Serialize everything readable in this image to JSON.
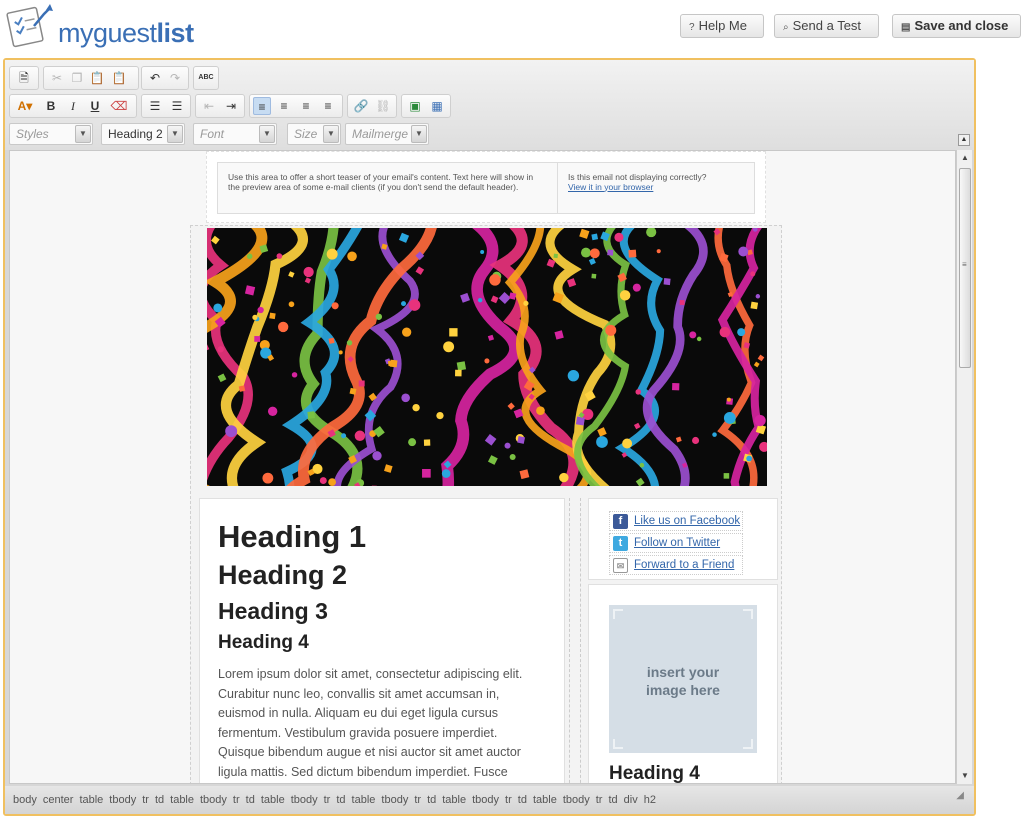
{
  "app": {
    "logo_prefix": "myguest",
    "logo_bold": "list"
  },
  "header_buttons": {
    "help": "Help Me",
    "help_icon": "?",
    "test": "Send a Test",
    "test_icon": "search-icon",
    "save": "Save and close",
    "save_icon": "disk-icon"
  },
  "toolbar": {
    "styles_placeholder": "Styles",
    "format_value": "Heading 2",
    "font_placeholder": "Font",
    "size_placeholder": "Size",
    "mailmerge_placeholder": "Mailmerge"
  },
  "email": {
    "preheader_left": "Use this area to offer a short teaser of your email's content. Text here will show in the preview area of some e-mail clients (if you don't send the default header).",
    "preheader_right_text": "Is this email not displaying correctly?",
    "preheader_right_link": "View it in your browser",
    "heading1": "Heading 1",
    "heading2": "Heading 2",
    "heading3": "Heading 3",
    "heading4": "Heading 4",
    "body_text": "Lorem ipsum dolor sit amet, consectetur adipiscing elit. Curabitur nunc leo, convallis sit amet accumsan in, euismod in nulla. Aliquam eu dui eget ligula cursus fermentum. Vestibulum gravida posuere imperdiet. Quisque bibendum augue et nisi auctor sit amet auctor ligula mattis. Sed dictum bibendum imperdiet. Fusce",
    "social": {
      "facebook": "Like us on Facebook",
      "twitter": "Follow on Twitter",
      "forward": "Forward to a Friend"
    },
    "image_placeholder_line1": "insert your",
    "image_placeholder_line2": "image here",
    "side_heading": "Heading 4"
  },
  "statusbar": {
    "path": [
      "body",
      "center",
      "table",
      "tbody",
      "tr",
      "td",
      "table",
      "tbody",
      "tr",
      "td",
      "table",
      "tbody",
      "tr",
      "td",
      "table",
      "tbody",
      "tr",
      "td",
      "table",
      "tbody",
      "tr",
      "td",
      "table",
      "tbody",
      "tr",
      "td",
      "div",
      "h2"
    ]
  },
  "colors": {
    "accent": "#3a6fb5",
    "editor_border": "#f0c060",
    "link": "#3366aa"
  }
}
